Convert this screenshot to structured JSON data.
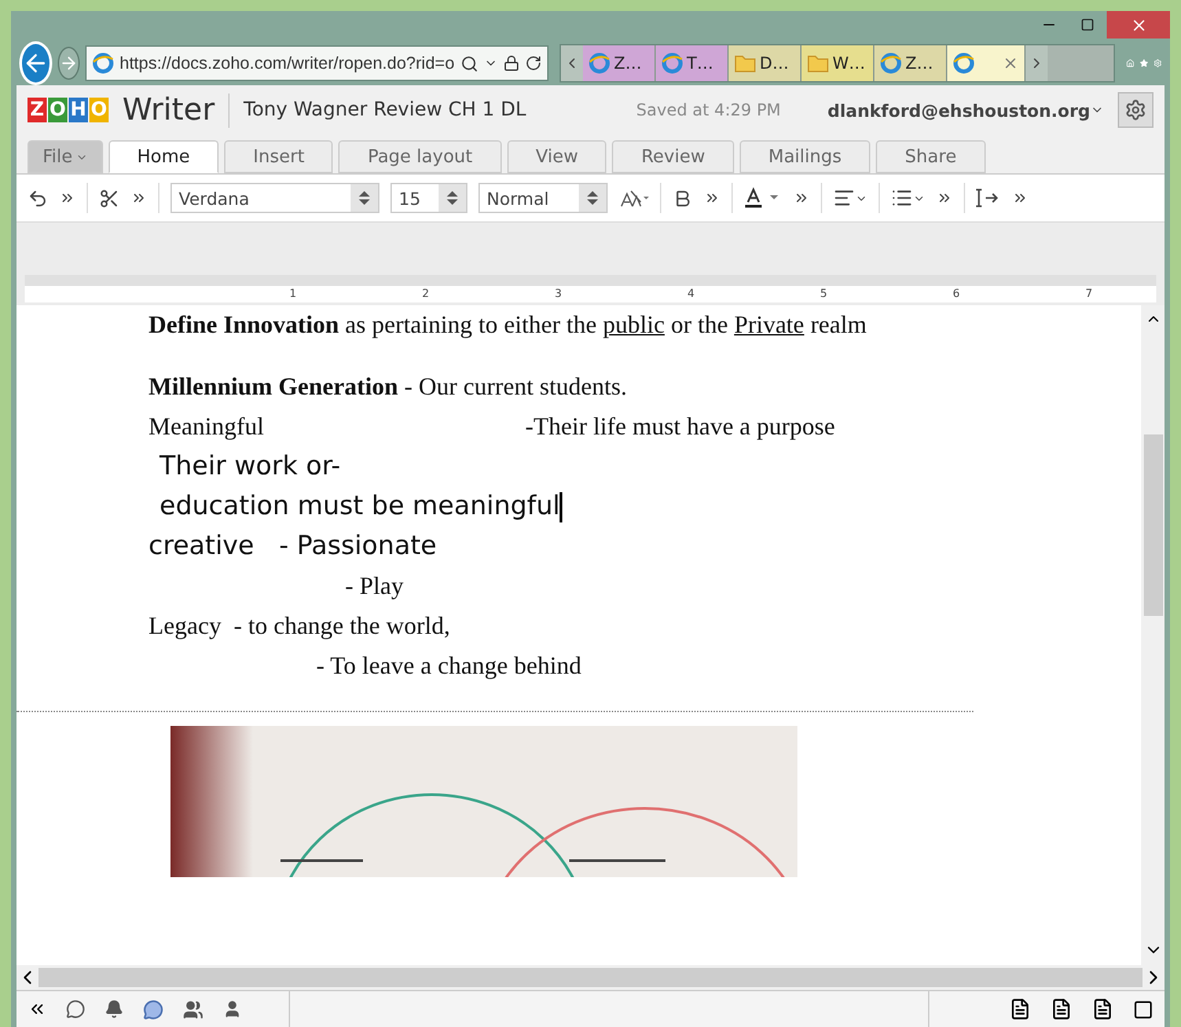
{
  "browser": {
    "url": "https://docs.zoho.com/writer/ropen.do?rid=o",
    "tabs": [
      {
        "label": "Z…",
        "kind": "web",
        "color": "#cfa6d6",
        "selected": false
      },
      {
        "label": "T…",
        "kind": "web",
        "color": "#cfa6d6",
        "selected": false
      },
      {
        "label": "D…",
        "kind": "folder",
        "color": "#ddd8a6",
        "selected": false
      },
      {
        "label": "W…",
        "kind": "folder",
        "color": "#e6de8e",
        "selected": false
      },
      {
        "label": "Z…",
        "kind": "web",
        "color": "#ddd8a6",
        "selected": false
      },
      {
        "kind": "web",
        "color": "#f8f4cc",
        "selected": true
      }
    ]
  },
  "app": {
    "logo": [
      {
        "char": "Z",
        "color": "#e02a2a"
      },
      {
        "char": "O",
        "color": "#3a9a3a"
      },
      {
        "char": "H",
        "color": "#2a78c8"
      },
      {
        "char": "O",
        "color": "#f0b400"
      }
    ],
    "name": "Writer",
    "doc_title": "Tony Wagner Review CH 1 DL",
    "saved": "Saved at 4:29 PM",
    "user": "dlankford@ehshouston.org"
  },
  "menu_tabs": [
    {
      "label": "File",
      "kind": "menu",
      "selected": false
    },
    {
      "label": "Home",
      "kind": "tab",
      "selected": true
    },
    {
      "label": "Insert",
      "kind": "tab",
      "selected": false
    },
    {
      "label": "Page layout",
      "kind": "tab",
      "selected": false
    },
    {
      "label": "View",
      "kind": "tab",
      "selected": false
    },
    {
      "label": "Review",
      "kind": "tab",
      "selected": false
    },
    {
      "label": "Mailings",
      "kind": "tab",
      "selected": false
    },
    {
      "label": "Share",
      "kind": "tab",
      "selected": false
    }
  ],
  "toolbar": {
    "font": "Verdana",
    "size": "15",
    "style": "Normal"
  },
  "ruler": {
    "labels": [
      "1",
      "2",
      "3",
      "4",
      "5",
      "6",
      "7"
    ]
  },
  "document": {
    "paragraphs": [
      {
        "kind": "caps",
        "runs": [
          {
            "text": "Define Innovation",
            "bold": true
          },
          {
            "text": " as pertaining to either the "
          },
          {
            "text": "public",
            "underline": true
          },
          {
            "text": " or the "
          },
          {
            "text": "Private",
            "underline": true
          },
          {
            "text": " realm"
          }
        ]
      },
      {
        "kind": "caps-spaced",
        "runs": [
          {
            "text": "Millennium Generation",
            "bold": true
          },
          {
            "text": " - Our current students."
          }
        ]
      },
      {
        "kind": "caps",
        "runs": [
          {
            "text": "Meaningful"
          },
          {
            "text": "-Their life must have a purpose",
            "kind": "tabbed"
          }
        ]
      },
      {
        "kind": "sans-offset",
        "runs": [
          {
            "text": "Their work or-"
          }
        ]
      },
      {
        "kind": "sans-offset",
        "cursor": true,
        "runs": [
          {
            "text": "education must be meaningful"
          }
        ]
      },
      {
        "kind": "sans",
        "runs": [
          {
            "text": "creative   - Passionate"
          }
        ]
      },
      {
        "kind": "caps-deep",
        "runs": [
          {
            "text": "- Play"
          }
        ]
      },
      {
        "kind": "caps",
        "runs": [
          {
            "text": "Legacy  - to change the world,"
          }
        ]
      },
      {
        "kind": "caps-mid",
        "runs": [
          {
            "text": "- To leave a change behind"
          }
        ]
      }
    ]
  }
}
